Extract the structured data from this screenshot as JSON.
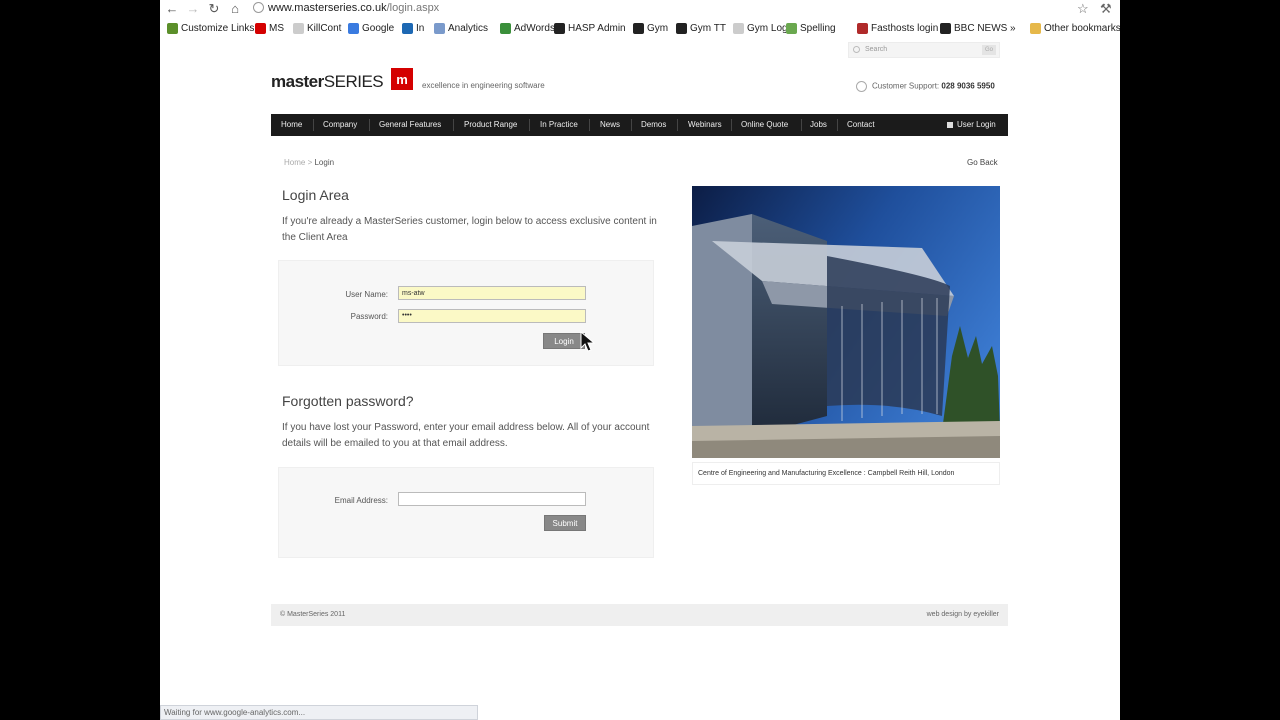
{
  "browser": {
    "url_host": "www.masterseries.co.uk",
    "url_path": "/login.aspx",
    "bookmarks": [
      {
        "label": "Customize Links",
        "color": "#5b8f2a"
      },
      {
        "label": "MS",
        "color": "#d40000"
      },
      {
        "label": "KillCont",
        "color": "#cccccc"
      },
      {
        "label": "Google",
        "color": "#3a7be0"
      },
      {
        "label": "In",
        "color": "#1d68b3"
      },
      {
        "label": "Analytics",
        "color": "#7a9acb"
      },
      {
        "label": "AdWords",
        "color": "#3a8f3a"
      },
      {
        "label": "HASP Admin",
        "color": "#222222"
      },
      {
        "label": "Gym",
        "color": "#222222"
      },
      {
        "label": "Gym TT",
        "color": "#222222"
      },
      {
        "label": "Gym Login",
        "color": "#cccccc"
      },
      {
        "label": "Spelling",
        "color": "#6aa84f"
      },
      {
        "label": "Fasthosts login",
        "color": "#b02a2a"
      },
      {
        "label": "BBC NEWS",
        "color": "#222222"
      }
    ],
    "other_bookmarks": "Other bookmarks",
    "more_bookmarks": "»",
    "status_text": "Waiting for www.google-analytics.com..."
  },
  "site": {
    "search_placeholder": "Search",
    "search_go": "Go",
    "logo_bold": "master",
    "logo_thin": "SERIES",
    "logo_mark": "m",
    "tagline": "excellence in engineering software",
    "support_label": "Customer Support:",
    "support_phone": "028 9036 5950",
    "nav": [
      "Home",
      "Company",
      "General Features",
      "Product Range",
      "In Practice",
      "News",
      "Demos",
      "Webinars",
      "Online Quote",
      "Jobs",
      "Contact"
    ],
    "nav_login": "User Login",
    "breadcrumb_home": "Home",
    "breadcrumb_sep": " > ",
    "breadcrumb_current": "Login",
    "go_back": "Go Back"
  },
  "login": {
    "title": "Login Area",
    "intro": "If you're already a MasterSeries customer, login below to access exclusive content in the Client Area",
    "username_label": "User Name:",
    "username_value": "ms-atw",
    "password_label": "Password:",
    "password_value": "••••",
    "button": "Login"
  },
  "forgot": {
    "title": "Forgotten password?",
    "intro": "If you have lost your Password, enter your email address below. All of your account details will be emailed to you at that email address.",
    "email_label": "Email Address:",
    "email_value": "",
    "button": "Submit"
  },
  "photo": {
    "caption": "Centre of Engineering and Manufacturing Excellence : Campbell Reith Hill, London"
  },
  "footer": {
    "copyright": "© MasterSeries 2011",
    "credit": "web design by eyekiller"
  }
}
